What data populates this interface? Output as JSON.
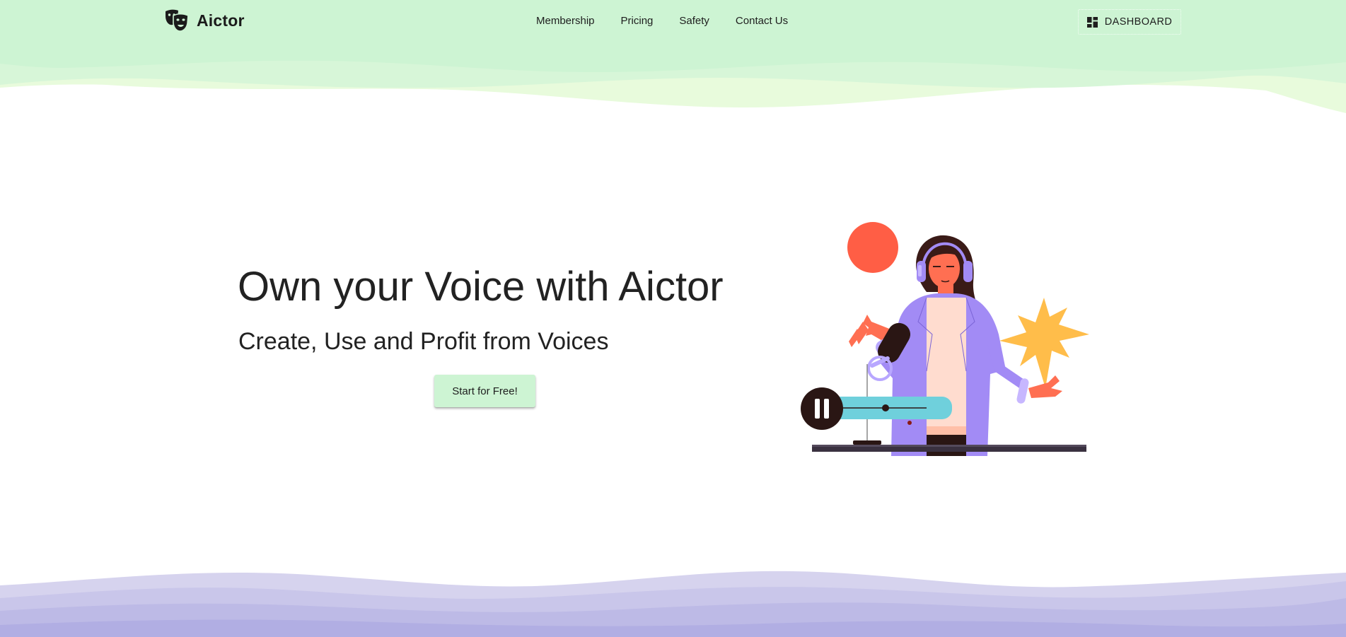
{
  "brand": {
    "name": "Aictor",
    "logo_icon": "theater-masks-icon"
  },
  "nav": {
    "links": [
      "Membership",
      "Pricing",
      "Safety",
      "Contact Us"
    ]
  },
  "dashboard_button": {
    "label": "DASHBOARD",
    "icon": "dashboard-grid-icon"
  },
  "hero": {
    "title": "Own your Voice with Aictor",
    "subtitle": "Create, Use and Profit from Voices",
    "cta_label": "Start for Free!"
  },
  "colors": {
    "header_green": "#cdf4d3",
    "header_light_green": "#e6fadc",
    "cta_green": "#cdf4d3",
    "footer_lavender": "#b3b1e6",
    "accent_purple": "#a28bf5",
    "accent_orange": "#ff5e45",
    "accent_yellow": "#ffbd4a",
    "accent_teal": "#6fd0dc"
  }
}
